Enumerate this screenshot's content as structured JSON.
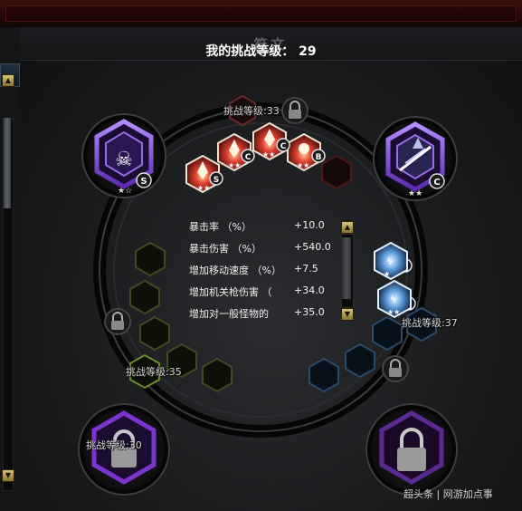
{
  "header": {
    "title": "符文"
  },
  "my_level": "我的挑战等级： 29",
  "slot_levels": {
    "top": "挑战等级:33",
    "right": "挑战等级:37",
    "left": "挑战等级:35",
    "bottom_left": "挑战等级:30"
  },
  "stats": [
    {
      "name": "暴击率 （%）",
      "value": "+10.0"
    },
    {
      "name": "暴击伤害 （%）",
      "value": "+540.0"
    },
    {
      "name": "增加移动速度 （%）",
      "value": "+7.5"
    },
    {
      "name": "增加机关枪伤害 （",
      "value": "+34.0"
    },
    {
      "name": "增加对一般怪物的",
      "value": "+35.0"
    }
  ],
  "emblems": {
    "top_left": {
      "grade": "S",
      "stars": 2,
      "icon": "skull-icon",
      "color": "#8a55e0"
    },
    "top_right": {
      "grade": "C",
      "stars": 2,
      "icon": "gun-icon",
      "color": "#8a55e0"
    },
    "bottom_left": {
      "locked": true,
      "color": "#7a35d0"
    },
    "bottom_right": {
      "locked": true,
      "color": "#5a2a90"
    }
  },
  "runes": {
    "red": [
      {
        "grade": "S",
        "stars": 2
      },
      {
        "grade": "C",
        "stars": 2
      },
      {
        "grade": "C",
        "stars": 2
      },
      {
        "grade": "B",
        "stars": 2
      }
    ],
    "blue": [
      {
        "grade": "C",
        "stars": 1
      },
      {
        "grade": "S",
        "stars": 2
      }
    ]
  },
  "watermark": "超头条 | 网游加点事",
  "colors": {
    "red_rune": "#c8423a",
    "blue_rune": "#4f8fc8",
    "green_slot": "#3f4a22",
    "emblem_purple": "#8a55e0",
    "accent_gold": "#d8c27a"
  }
}
